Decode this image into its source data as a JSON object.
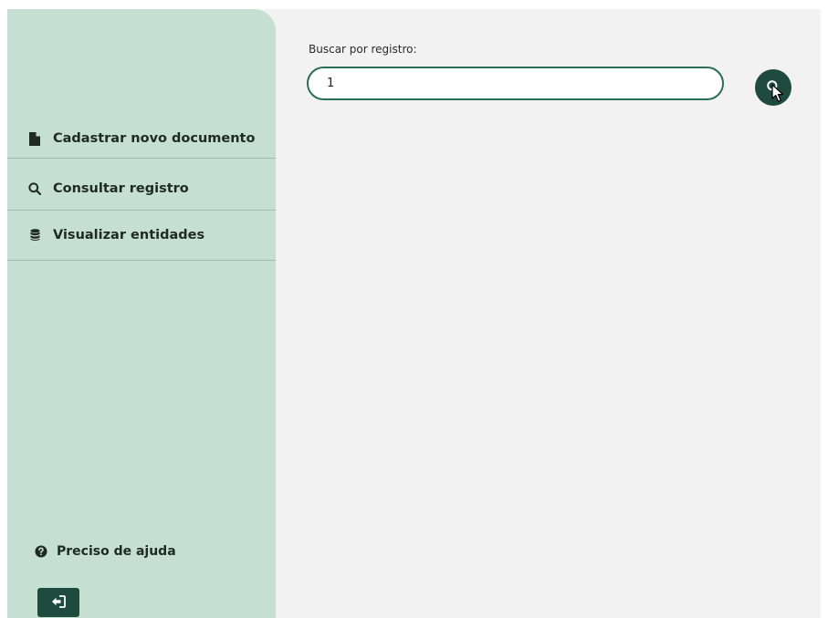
{
  "sidebar": {
    "items": [
      {
        "label": "Cadastrar novo documento",
        "icon": "file-icon"
      },
      {
        "label": "Consultar registro",
        "icon": "search-icon"
      },
      {
        "label": "Visualizar entidades",
        "icon": "database-icon"
      }
    ],
    "help_label": "Preciso de ajuda",
    "help_icon": "question-circle-icon",
    "logout_icon": "sign-out-icon"
  },
  "search": {
    "label": "Buscar por registro:",
    "value": "1",
    "button_icon": "search-icon"
  },
  "colors": {
    "sidebar_bg": "#c6dfd3",
    "accent_dark": "#1f4b3e",
    "input_border": "#2a6e59",
    "content_bg": "#f2f2f2"
  }
}
